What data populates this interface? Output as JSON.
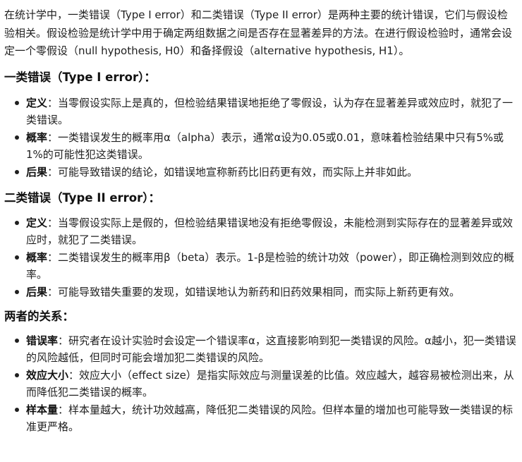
{
  "intro": "在统计学中，一类错误（Type I error）和二类错误（Type II error）是两种主要的统计错误，它们与假设检验相关。假设检验是统计学中用于确定两组数据之间是否存在显著差异的方法。在进行假设检验时，通常会设定一个零假设（null hypothesis, H0）和备择假设（alternative hypothesis, H1）。",
  "sections": [
    {
      "heading": "一类错误（Type I error）：",
      "items": [
        {
          "term": "定义",
          "sep": "：",
          "text": "当零假设实际上是真的，但检验结果错误地拒绝了零假设，认为存在显著差异或效应时，就犯了一类错误。"
        },
        {
          "term": "概率",
          "sep": "：",
          "text": "一类错误发生的概率用α（alpha）表示，通常α设为0.05或0.01，意味着检验结果中只有5%或1%的可能性犯这类错误。"
        },
        {
          "term": "后果",
          "sep": "：",
          "text": "可能导致错误的结论，如错误地宣称新药比旧药更有效，而实际上并非如此。"
        }
      ]
    },
    {
      "heading": "二类错误（Type II error）：",
      "items": [
        {
          "term": "定义",
          "sep": "：",
          "text": "当零假设实际上是假的，但检验结果错误地没有拒绝零假设，未能检测到实际存在的显著差异或效应时，就犯了二类错误。"
        },
        {
          "term": "概率",
          "sep": "：",
          "text": "二类错误发生的概率用β（beta）表示。1-β是检验的统计功效（power），即正确检测到效应的概率。"
        },
        {
          "term": "后果",
          "sep": "：",
          "text": "可能导致错失重要的发现，如错误地认为新药和旧药效果相同，而实际上新药更有效。"
        }
      ]
    },
    {
      "heading": "两者的关系：",
      "items": [
        {
          "term": "错误率",
          "sep": "：",
          "text": "研究者在设计实验时会设定一个错误率α，这直接影响到犯一类错误的风险。α越小，犯一类错误的风险越低，但同时可能会增加犯二类错误的风险。"
        },
        {
          "term": "效应大小",
          "sep": "：",
          "text": "效应大小（effect size）是指实际效应与测量误差的比值。效应越大，越容易被检测出来，从而降低犯二类错误的概率。"
        },
        {
          "term": "样本量",
          "sep": "：",
          "text": "样本量越大，统计功效越高，降低犯二类错误的风险。但样本量的增加也可能导致一类错误的标准更严格。"
        }
      ]
    }
  ]
}
